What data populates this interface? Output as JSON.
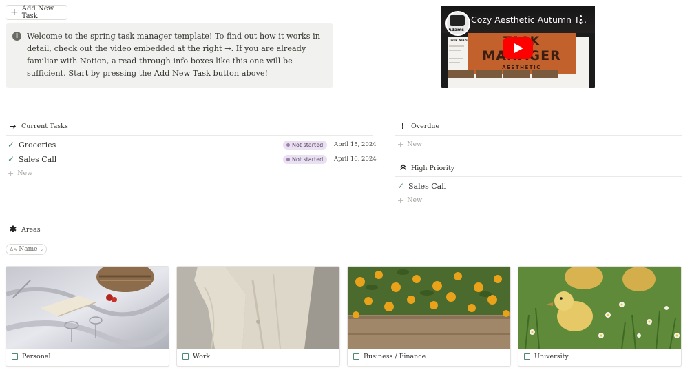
{
  "top": {
    "add_task_label": "Add New Task",
    "callout_text": "Welcome to the spring task manager template! To find out how it works in detail, check out the video embedded at the right →. If you are already familiar with Notion, a read through info boxes like this one will be sufficient. Start by pressing the Add New Task button above!"
  },
  "video": {
    "title": "Cozy Aesthetic Autumn T...",
    "channel_mark": "Adams",
    "thumb_heading": "TASK",
    "thumb_heading2": "MANAGER",
    "thumb_sub": "AESTHETIC",
    "doc_title": "Task Manager",
    "play_color": "#ff0000"
  },
  "current_tasks": {
    "title": "Current Tasks",
    "icon": "arrow-right-icon",
    "rows": [
      {
        "name": "Groceries",
        "status": "Not started",
        "date": "April 15, 2024"
      },
      {
        "name": "Sales Call",
        "status": "Not started",
        "date": "April 16, 2024"
      }
    ],
    "new_label": "New"
  },
  "overdue": {
    "title": "Overdue",
    "icon": "exclamation-icon",
    "new_label": "New"
  },
  "high_priority": {
    "title": "High Priority",
    "icon": "double-chevron-up-icon",
    "rows": [
      {
        "name": "Sales Call"
      }
    ],
    "new_label": "New"
  },
  "areas": {
    "title": "Areas",
    "icon": "asterisk-icon",
    "filter": {
      "prefix": "Aa",
      "label": "Name"
    },
    "cards": [
      {
        "label": "Personal"
      },
      {
        "label": "Work"
      },
      {
        "label": "Business / Finance"
      },
      {
        "label": "University"
      }
    ]
  },
  "colors": {
    "check_green": "#4e8a72",
    "status_pill_bg": "#e9e0f1",
    "callout_bg": "#f1f1ef"
  }
}
